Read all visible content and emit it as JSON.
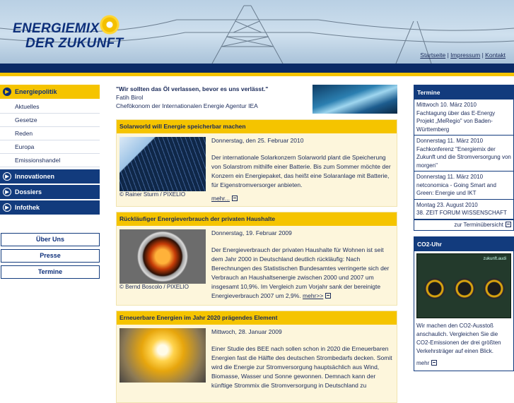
{
  "header": {
    "logo_line1": "ENERGIEMIX",
    "logo_line2": "DER ZUKUNFT",
    "links": [
      "Startseite",
      "Impressum",
      "Kontakt"
    ],
    "sep": "|"
  },
  "nav": {
    "active": "Energiepolitik",
    "sub": [
      "Aktuelles",
      "Gesetze",
      "Reden",
      "Europa",
      "Emissionshandel"
    ],
    "sections": [
      "Innovationen",
      "Dossiers",
      "Infothek"
    ],
    "buttons": [
      "Über Uns",
      "Presse",
      "Termine"
    ]
  },
  "quote": {
    "text": "\"Wir sollten das Öl verlassen, bevor es uns verlässt.\"",
    "name": "Fatih Birol",
    "role": "Chefökonom der Internationalen Energie Agentur IEA"
  },
  "articles": [
    {
      "title": "Solarworld will Energie speicherbar machen",
      "date": "Donnerstag, den 25. Februar 2010",
      "caption": "© Rainer Sturm / PIXELIO",
      "body": "Der internationale Solarkonzern Solarworld plant die Speicherung von Solarstrom mithilfe einer Batterie. Bis zum Sommer möchte der Konzern ein Energiepaket, das heißt eine Solaranlage mit Batterie, für Eigenstromversorger anbieten.",
      "more": "mehr..."
    },
    {
      "title": "Rückläufiger Energieverbrauch der privaten Haushalte",
      "date": "Donnerstag, 19. Februar 2009",
      "caption": "© Bernd Boscolo / PIXELIO",
      "body": "Der Energieverbrauch der privaten Haushalte für Wohnen ist seit dem Jahr 2000 in Deutschland deutlich rückläufig: Nach Berechnungen des Statistischen Bundesamtes verringerte sich der Verbrauch an Haushaltsenergie zwischen 2000 und 2007 um insgesamt 10,9%. Im Vergleich zum Vorjahr sank der bereinigte Energieverbrauch 2007 um 2,9%.",
      "more": "mehr>>"
    },
    {
      "title": "Erneuerbare Energien im Jahr 2020 prägendes Element",
      "date": "Mittwoch, 28. Januar 2009",
      "caption": "",
      "body": "Einer Studie des BEE nach sollen schon in 2020 die Erneuerbaren Energien fast die Hälfte des deutschen Strombedarfs decken. Somit wird die Energie zur Stromversorgung hauptsächlich aus Wind, Biomasse, Wasser und Sonne gewonnen. Demnach kann der künftige Strommix die Stromversorgung in Deutschland zu",
      "more": ""
    }
  ],
  "termine": {
    "title": "Termine",
    "items": [
      {
        "date": "Mittwoch 10. März 2010",
        "text": "Fachtagung über das E-Energy Projekt „MeRegio\" von Baden-Württemberg"
      },
      {
        "date": "Donnerstag 11. März 2010",
        "text": "Fachkonferenz \"Energiemix der Zukunft und die Stromversorgung von morgen\""
      },
      {
        "date": "Donnerstag 11. März 2010",
        "text": "netconomica - Going Smart and Green: Energie und IKT"
      },
      {
        "date": "Montag 23. August 2010",
        "text": "38. ZEIT FORUM WISSENSCHAFT"
      }
    ],
    "all": "zur Terminübersicht"
  },
  "co2": {
    "title": "CO2-Uhr",
    "text": "Wir machen den CO2-Ausstoß anschaulich. Vergleichen Sie die CO2-Emissionen der drei größten Verkehrsträger auf einen Blick.",
    "more": "mehr",
    "img_title": "zukunft.audi"
  }
}
